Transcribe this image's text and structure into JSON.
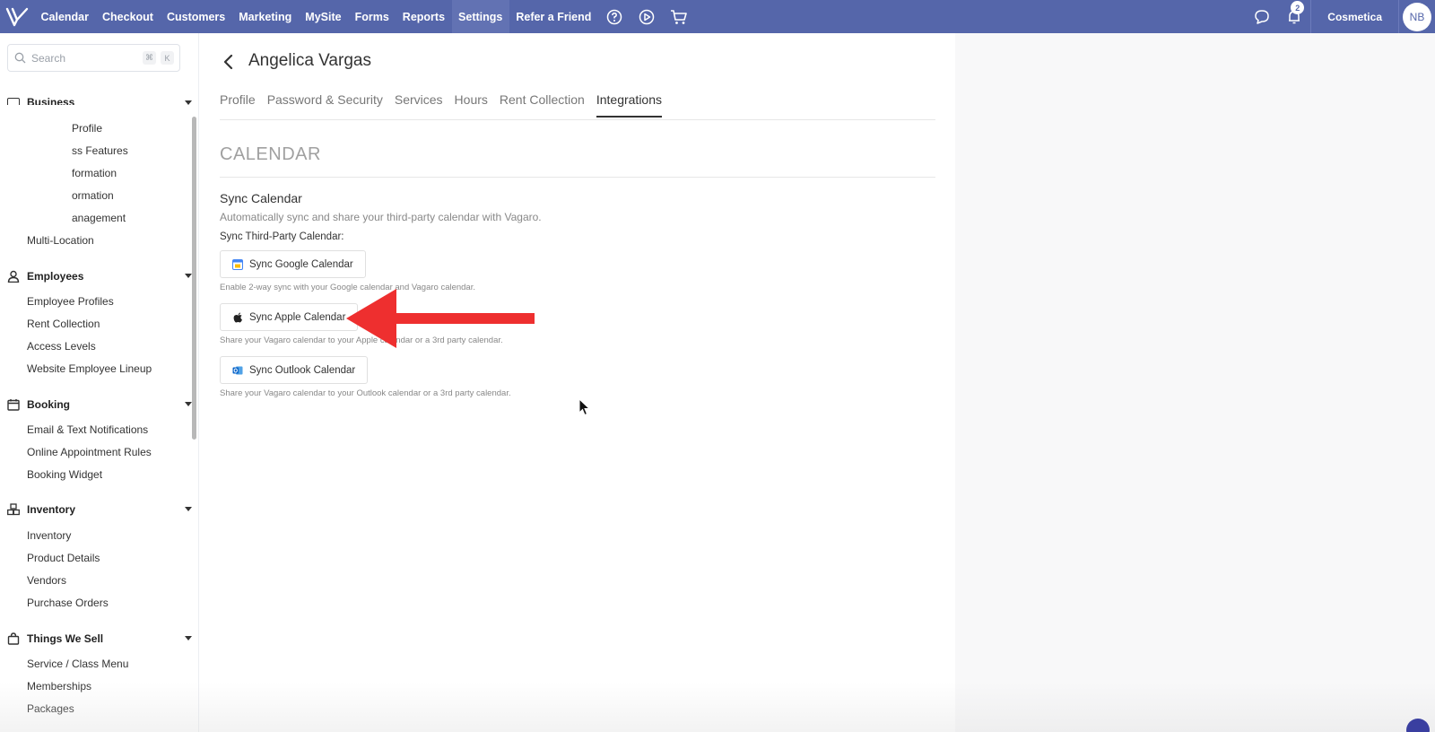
{
  "topnav": {
    "items": [
      "Calendar",
      "Checkout",
      "Customers",
      "Marketing",
      "MySite",
      "Forms",
      "Reports",
      "Settings",
      "Refer a Friend"
    ],
    "active": "Settings",
    "notification_count": "2",
    "business_name": "Cosmetica",
    "avatar_initials": "NB"
  },
  "sidebar": {
    "search_placeholder": "Search",
    "shortcut_keys": [
      "⌘",
      "K"
    ],
    "partial_header": "Business",
    "business_items": [
      "Profile",
      "ss Features",
      "formation",
      "ormation",
      "anagement"
    ],
    "multi_location": "Multi-Location",
    "sections": [
      {
        "title": "Employees",
        "icon": "user-icon",
        "items": [
          "Employee Profiles",
          "Rent Collection",
          "Access Levels",
          "Website Employee Lineup"
        ]
      },
      {
        "title": "Booking",
        "icon": "calendar-icon",
        "items": [
          "Email & Text Notifications",
          "Online Appointment Rules",
          "Booking Widget"
        ]
      },
      {
        "title": "Inventory",
        "icon": "boxes-icon",
        "items": [
          "Inventory",
          "Product Details",
          "Vendors",
          "Purchase Orders"
        ]
      },
      {
        "title": "Things We Sell",
        "icon": "shopping-bag-icon",
        "items": [
          "Service / Class Menu",
          "Memberships",
          "Packages"
        ]
      }
    ]
  },
  "main": {
    "employee_name": "Angelica Vargas",
    "tabs": [
      "Profile",
      "Password & Security",
      "Services",
      "Hours",
      "Rent Collection",
      "Integrations"
    ],
    "active_tab": "Integrations",
    "section_title": "CALENDAR",
    "sync_title": "Sync Calendar",
    "sync_subtitle": "Automatically sync and share your third-party calendar with Vagaro.",
    "sync_label": "Sync Third-Party Calendar:",
    "buttons": [
      {
        "label": "Sync Google Calendar",
        "icon": "google-calendar-icon",
        "helper": "Enable 2-way sync with your Google calendar and Vagaro calendar."
      },
      {
        "label": "Sync Apple Calendar",
        "icon": "apple-icon",
        "helper": "Share your Vagaro calendar to your Apple calendar or a 3rd party calendar."
      },
      {
        "label": "Sync Outlook Calendar",
        "icon": "outlook-icon",
        "helper": "Share your Vagaro calendar to your Outlook calendar or a 3rd party calendar."
      }
    ]
  },
  "colors": {
    "nav_bg": "#5566aa",
    "annotation_arrow": "#ee2f2f"
  }
}
